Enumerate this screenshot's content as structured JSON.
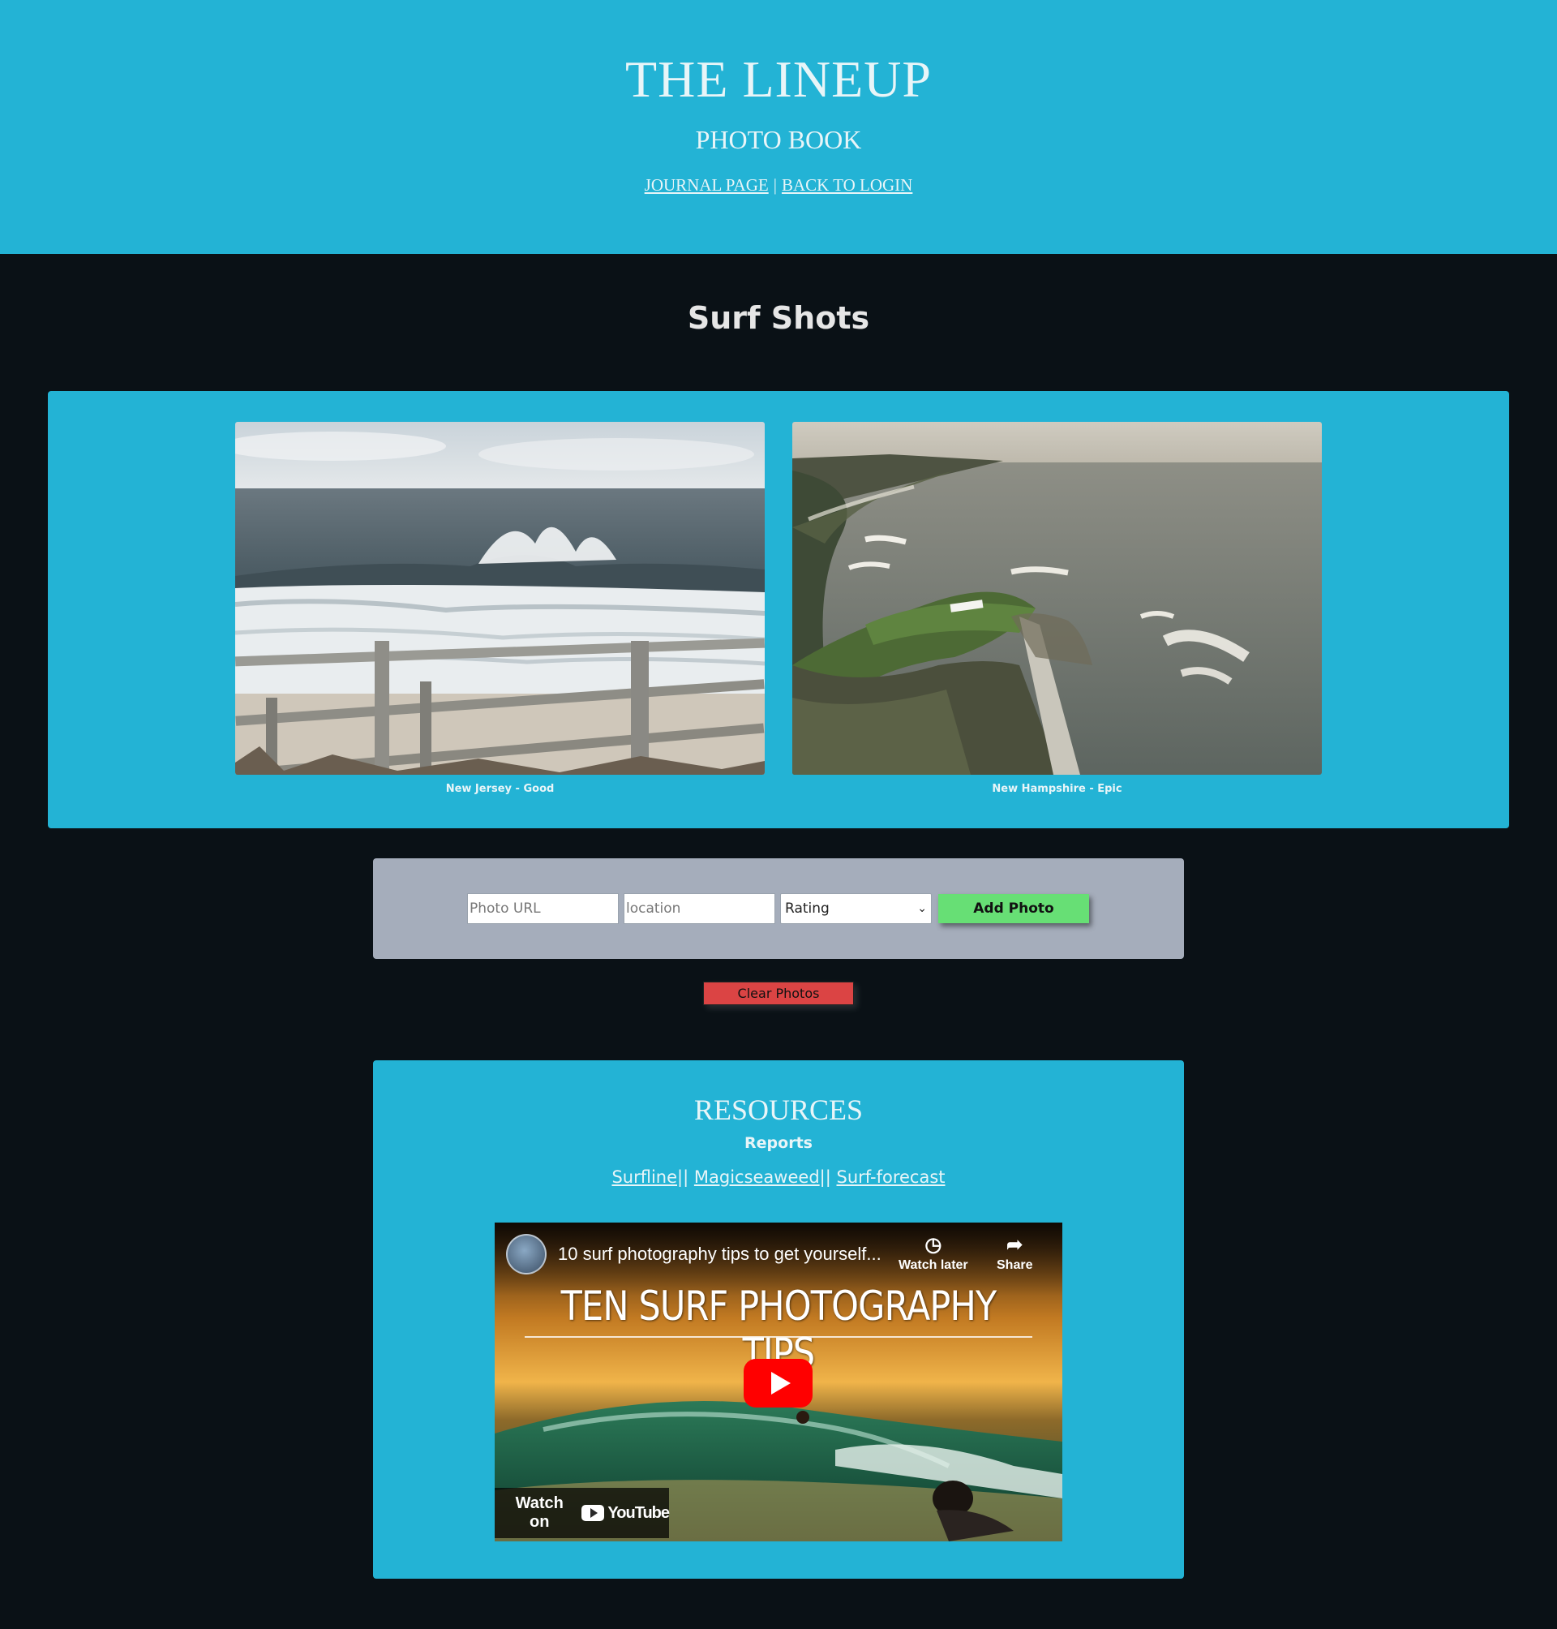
{
  "header": {
    "title": "THE LINEUP",
    "subtitle": "PHOTO BOOK",
    "nav": {
      "journal_link": "JOURNAL PAGE",
      "separator": "|",
      "login_link": "BACK TO LOGIN"
    }
  },
  "section_title": "Surf Shots",
  "gallery": {
    "photos": [
      {
        "caption": "New Jersey - Good",
        "scene": "breaking-wave-fence-photo"
      },
      {
        "caption": "New Hampshire - Epic",
        "scene": "aerial-coastline-jetty-photo"
      }
    ]
  },
  "form": {
    "url_placeholder": "Photo URL",
    "location_placeholder": "location",
    "rating_selected": "Rating",
    "add_label": "Add Photo"
  },
  "clear_label": "Clear Photos",
  "resources": {
    "title": "RESOURCES",
    "subtitle": "Reports",
    "links": [
      "Surfline",
      "Magicseaweed",
      "Surf-forecast"
    ],
    "link_separator": "||",
    "video": {
      "title": "10 surf photography tips to get yourself...",
      "watch_later": "Watch later",
      "share": "Share",
      "headline": "TEN SURF PHOTOGRAPHY TIPS",
      "watch_on": "Watch on",
      "brand": "YouTube"
    }
  },
  "colors": {
    "brand_cyan": "#23b3d5",
    "page_bg": "#0a1116",
    "form_bg": "#a5adbb",
    "add_button": "#67df75",
    "clear_button": "#db4444",
    "youtube_red": "#ff0000"
  }
}
